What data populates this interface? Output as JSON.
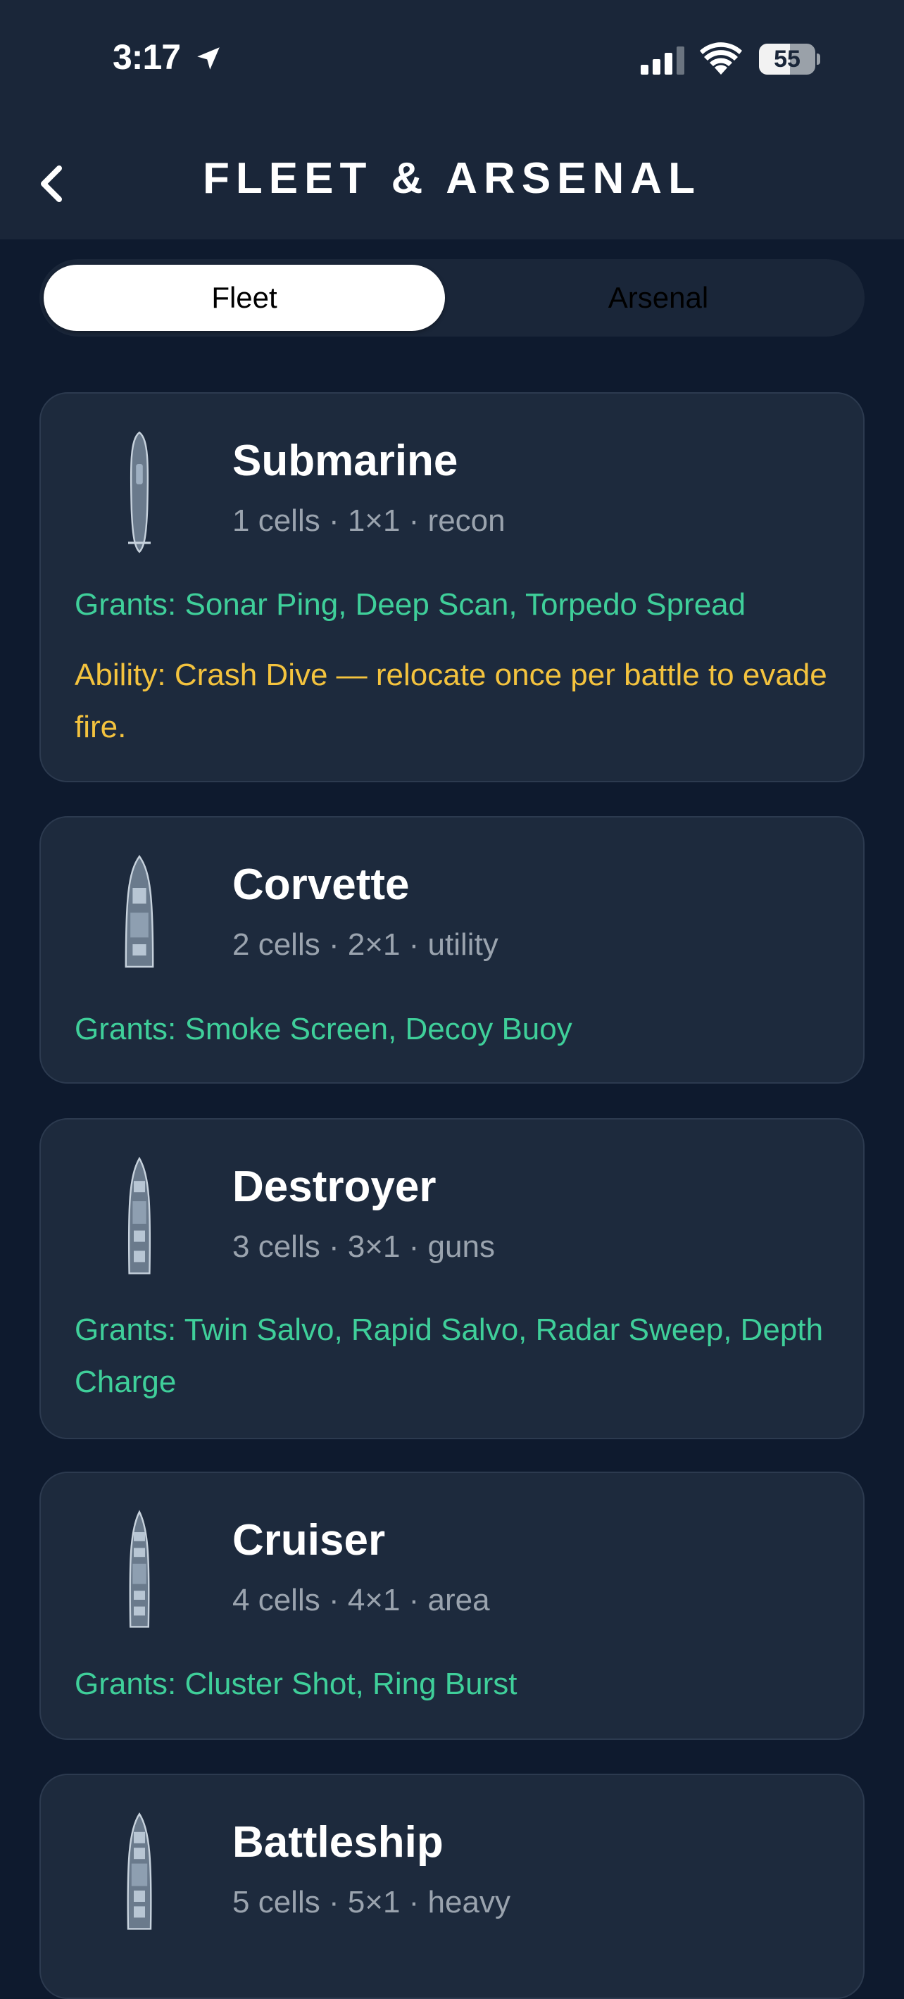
{
  "status_bar": {
    "time": "3:17",
    "battery": "55",
    "battery_level": 0.55
  },
  "header": {
    "title": "FLEET & ARSENAL"
  },
  "tabs": [
    {
      "label": "Fleet",
      "selected": true
    },
    {
      "label": "Arsenal",
      "selected": false
    }
  ],
  "ships": [
    {
      "name": "Submarine",
      "meta": "1 cells · 1×1 · recon",
      "grants": "Grants: Sonar Ping, Deep Scan, Torpedo Spread",
      "ability": "Ability: Crash Dive — relocate once per battle to evade fire."
    },
    {
      "name": "Corvette",
      "meta": "2 cells · 2×1 · utility",
      "grants": "Grants: Smoke Screen, Decoy Buoy"
    },
    {
      "name": "Destroyer",
      "meta": "3 cells · 3×1 · guns",
      "grants": "Grants: Twin Salvo, Rapid Salvo, Radar Sweep, Depth Charge"
    },
    {
      "name": "Cruiser",
      "meta": "4 cells · 4×1 · area",
      "grants": "Grants: Cluster Shot, Ring Burst"
    },
    {
      "name": "Battleship",
      "meta": "5 cells · 5×1 · heavy"
    }
  ],
  "colors": {
    "background": "#0e1a2e",
    "card": "#1d2a3d",
    "grants": "#3fcf9a",
    "ability": "#f4c33e",
    "meta": "#9aa3ae"
  },
  "icons": {
    "back": "chevron-left-icon",
    "location": "location-arrow-icon",
    "signal": "cellular-signal-icon",
    "wifi": "wifi-icon",
    "ship": "ship-topdown-icon"
  }
}
